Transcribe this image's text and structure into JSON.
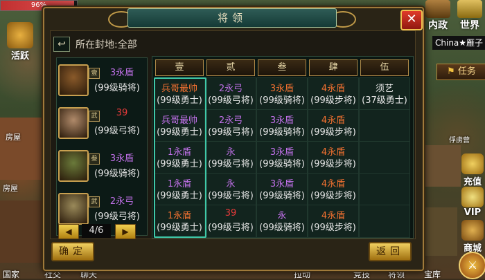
{
  "hud": {
    "exp_percent": "96%",
    "exp_fraction": 0.96,
    "left_buttons": [
      {
        "label": "活跃"
      }
    ],
    "left_map_labels": [
      "房屋",
      "房屋"
    ],
    "top_right": [
      {
        "label": "内政"
      },
      {
        "label": "世界"
      }
    ],
    "player_name": "China★雁子",
    "task_label": "任务",
    "map_label": "俘虏营",
    "right_side": [
      {
        "label": "充值"
      },
      {
        "label": "VIP"
      },
      {
        "label": "商城"
      }
    ],
    "bottom": [
      "国家",
      "社交",
      "聊天",
      "拉动",
      "竞技",
      "将领",
      "宝库"
    ]
  },
  "dialog": {
    "title": "将领",
    "close_symbol": "✕",
    "back_symbol": "↩",
    "filter_text": "所在封地:全部",
    "pager": {
      "prev": "◀",
      "page": "4/6",
      "next": "▶"
    },
    "confirm_label": "确定",
    "back_label": "返回"
  },
  "generals": [
    {
      "badge": "壹",
      "troop": "3永盾",
      "troop_color": "#c070e8",
      "level": "(99级骑将)"
    },
    {
      "badge": "武",
      "troop": "39",
      "troop_color": "#e83a3a",
      "level": "(99级弓将)"
    },
    {
      "badge": "叁",
      "troop": "3永盾",
      "troop_color": "#c070e8",
      "level": "(99级骑将)"
    },
    {
      "badge": "武",
      "troop": "2永弓",
      "troop_color": "#c070e8",
      "level": "(99级弓将)"
    }
  ],
  "columns": [
    "壹",
    "贰",
    "叁",
    "肆",
    "伍"
  ],
  "cells": [
    [
      {
        "t": "兵哥最帅",
        "c": "#f07030",
        "l": "(99级勇士)"
      },
      {
        "t": "2永弓",
        "c": "#c070e8",
        "l": "(99级弓将)"
      },
      {
        "t": "3永盾",
        "c": "#f07030",
        "l": "(99级骑将)"
      },
      {
        "t": "4永盾",
        "c": "#f07030",
        "l": "(99级步将)"
      },
      {
        "t": "须艺",
        "c": "#e8e8e8",
        "l": "(37级勇士)"
      }
    ],
    [
      {
        "t": "兵哥最帅",
        "c": "#c070e8",
        "l": "(99级勇士)"
      },
      {
        "t": "2永弓",
        "c": "#c070e8",
        "l": "(99级弓将)"
      },
      {
        "t": "3永盾",
        "c": "#c070e8",
        "l": "(99级骑将)"
      },
      {
        "t": "4永盾",
        "c": "#f07030",
        "l": "(99级步将)"
      },
      {
        "t": "",
        "c": "#e8e8e8",
        "l": ""
      }
    ],
    [
      {
        "t": "1永盾",
        "c": "#c070e8",
        "l": "(99级勇士)"
      },
      {
        "t": "永",
        "c": "#c070e8",
        "l": "(99级弓将)"
      },
      {
        "t": "3永盾",
        "c": "#c070e8",
        "l": "(99级骑将)"
      },
      {
        "t": "4永盾",
        "c": "#f07030",
        "l": "(99级步将)"
      },
      {
        "t": "",
        "c": "#e8e8e8",
        "l": ""
      }
    ],
    [
      {
        "t": "1永盾",
        "c": "#c070e8",
        "l": "(99级勇士)"
      },
      {
        "t": "永",
        "c": "#c070e8",
        "l": "(99级弓将)"
      },
      {
        "t": "3永盾",
        "c": "#c070e8",
        "l": "(99级骑将)"
      },
      {
        "t": "4永盾",
        "c": "#f07030",
        "l": "(99级步将)"
      },
      {
        "t": "",
        "c": "#e8e8e8",
        "l": ""
      }
    ],
    [
      {
        "t": "1永盾",
        "c": "#f07030",
        "l": "(99级勇士)"
      },
      {
        "t": "39",
        "c": "#e83a3a",
        "l": "(99级弓将)"
      },
      {
        "t": "永",
        "c": "#c070e8",
        "l": "(99级骑将)"
      },
      {
        "t": "4永盾",
        "c": "#f07030",
        "l": "(99级步将)"
      },
      {
        "t": "",
        "c": "#e8e8e8",
        "l": ""
      }
    ]
  ],
  "colors": {
    "selected_column": "#3fc8a8",
    "orange_troop": "#f07030",
    "purple_troop": "#c070e8",
    "red_troop": "#e83a3a"
  }
}
